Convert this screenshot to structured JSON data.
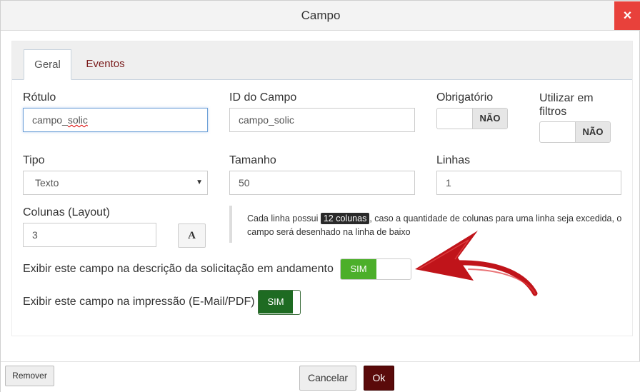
{
  "dialog": {
    "title": "Campo",
    "close_icon": "×"
  },
  "tabs": [
    {
      "label": "Geral",
      "active": true
    },
    {
      "label": "Eventos",
      "active": false
    }
  ],
  "fields": {
    "rotulo": {
      "label": "Rótulo",
      "value_prefix": "campo_",
      "value_misspelled": "solic"
    },
    "id_campo": {
      "label": "ID do Campo",
      "value": "campo_solic"
    },
    "obrigatorio": {
      "label": "Obrigatório",
      "toggle": "NÃO"
    },
    "utilizar_filtros": {
      "label": "Utilizar em filtros",
      "toggle": "NÃO"
    },
    "tipo": {
      "label": "Tipo",
      "selected": "Texto"
    },
    "tamanho": {
      "label": "Tamanho",
      "value": "50"
    },
    "linhas": {
      "label": "Linhas",
      "value": "1"
    },
    "colunas": {
      "label": "Colunas (Layout)",
      "value": "3",
      "font_button": "A"
    }
  },
  "info": {
    "before": "Cada linha possui ",
    "highlight": "12 colunas",
    "after": ", caso a quantidade de colunas para uma linha seja excedida, o campo será desenhado na linha de baixo"
  },
  "options": {
    "descricao": {
      "label": "Exibir este campo na descrição da solicitação em andamento",
      "toggle": "SIM"
    },
    "impressao": {
      "label": "Exibir este campo na impressão (E-Mail/PDF)",
      "toggle": "SIM"
    }
  },
  "footer": {
    "remove": "Remover",
    "cancel": "Cancelar",
    "ok": "Ok"
  },
  "colors": {
    "close": "#e8413b",
    "tab_eventos": "#7a1b1b",
    "toggle_green_light": "#4caf2a",
    "toggle_green_dark": "#1e6b22",
    "ok_button": "#5a0a0a",
    "arrow": "#c0141a"
  },
  "icons": {
    "close": "close-icon",
    "select_caret": "caret-down-icon",
    "font": "font-icon",
    "annotation_arrow": "red-arrow-annotation"
  }
}
